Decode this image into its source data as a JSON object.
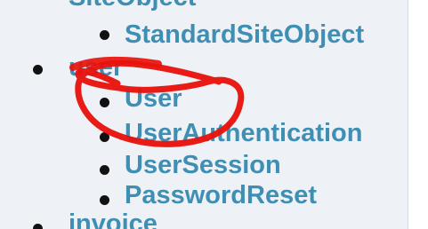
{
  "tree": {
    "parent_top": "SiteObject",
    "children_top": [
      "StandardSiteObject"
    ],
    "user_group": "user",
    "user_children": [
      "User",
      "UserAuthentication",
      "UserSession",
      "PasswordReset"
    ],
    "next_group": "invoice"
  },
  "colors": {
    "link": "#3f8fb4",
    "bullet": "#111111",
    "panel_bg": "#eef2f6",
    "annotation_red": "#e8120c"
  }
}
